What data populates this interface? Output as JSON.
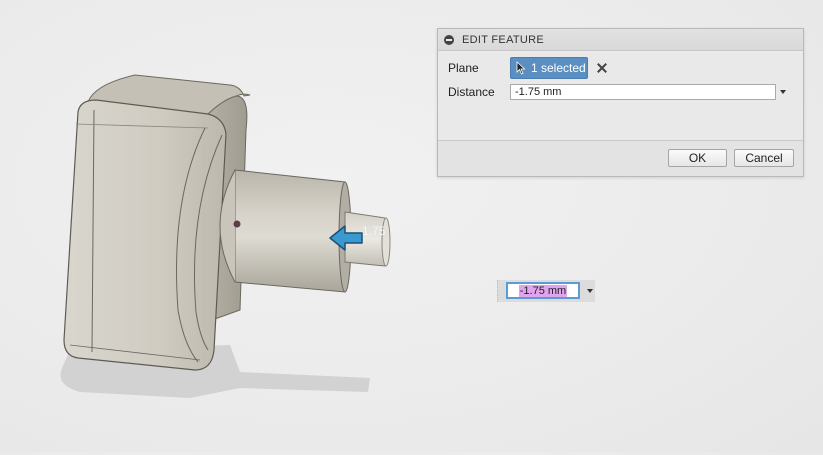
{
  "dialog": {
    "title": "EDIT FEATURE",
    "plane_label": "Plane",
    "plane_selection": "1 selected",
    "distance_label": "Distance",
    "distance_value": "-1.75 mm",
    "ok_label": "OK",
    "cancel_label": "Cancel"
  },
  "viewport": {
    "manipulator_value": "1.75",
    "floating_input_value": "-1.75 mm"
  },
  "colors": {
    "selection_button": "#5b8fc2",
    "input_focus": "#5a9bd8",
    "text_highlight": "#e0a3ee",
    "arrow": "#3a9ad0"
  },
  "icons": {
    "collapse": "minus-circle-icon",
    "select": "cursor-arrow-icon",
    "clear": "close-icon",
    "dropdown": "chevron-down-icon",
    "manipulator": "offset-arrow-icon"
  }
}
